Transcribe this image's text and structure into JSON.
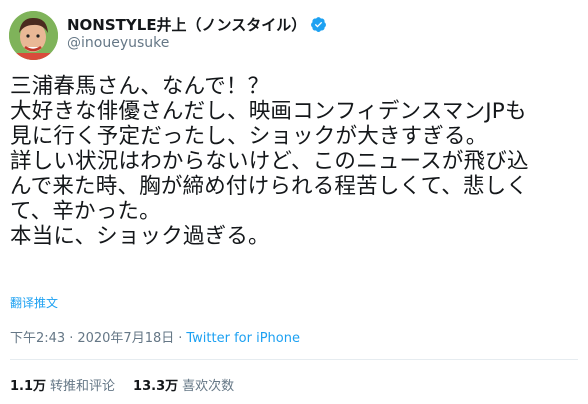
{
  "user": {
    "display_name": "NONSTYLE井上（ノンスタイル）",
    "handle": "@inoueyusuke"
  },
  "tweet": {
    "lines": [
      "三浦春馬さん、なんで！？",
      "大好きな俳優さんだし、映画コンフィデンスマンJPも",
      "見に行く予定だったし、ショックが大きすぎる。",
      "詳しい状況はわからないけど、このニュースが飛び込",
      "んで来た時、胸が締め付けられる程苦しくて、悲しく",
      "て、辛かった。",
      "本当に、ショック過ぎる。"
    ],
    "translate_label": "翻译推文",
    "time": "下午2:43",
    "date": "2020年7月18日",
    "separator": "·",
    "source": "Twitter for iPhone"
  },
  "stats": {
    "retweets_count": "1.1万",
    "retweets_label": "转推和评论",
    "likes_count": "13.3万",
    "likes_label": "喜欢次数"
  },
  "colors": {
    "link": "#1da1f2",
    "secondary_text": "#657786",
    "primary_text": "#14171a",
    "divider": "#e6ecf0"
  },
  "icons": [
    "verified-badge-icon",
    "avatar"
  ]
}
